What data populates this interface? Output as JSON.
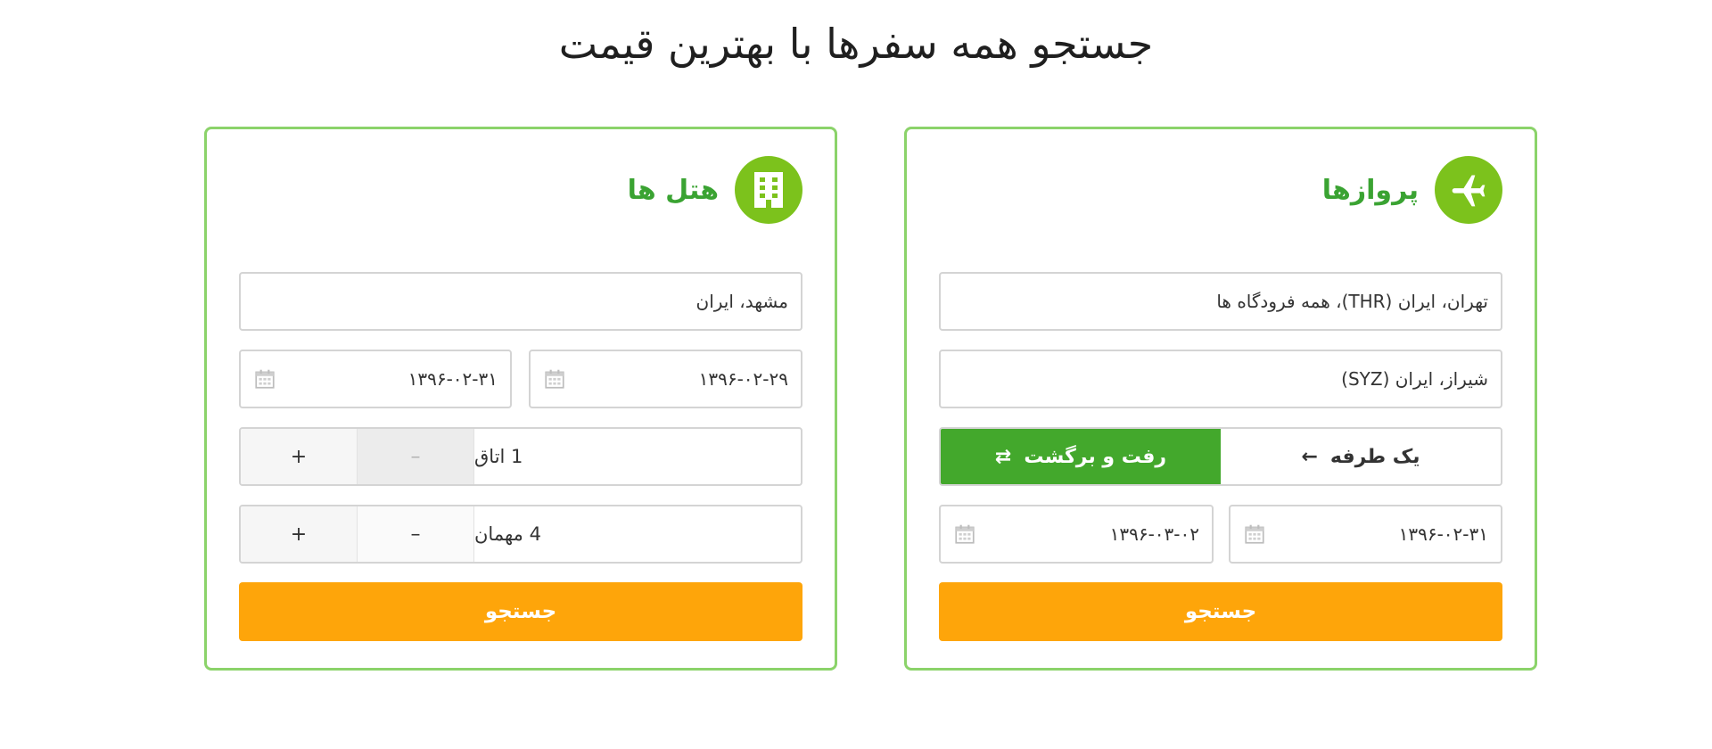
{
  "page": {
    "title": "جستجو همه سفرها با بهترین قیمت"
  },
  "flights": {
    "title": "پروازها",
    "icon": "airplane-icon",
    "origin": "تهران، ایران (THR)، همه فرودگاه ها",
    "destination": "شیراز، ایران (SYZ)",
    "trip_type": {
      "one_way": "یک طرفه",
      "round_trip": "رفت و برگشت",
      "selected": "round_trip"
    },
    "depart_date": "۱۳۹۶-۰۲-۳۱",
    "return_date": "۱۳۹۶-۰۳-۰۲",
    "search_label": "جستجو"
  },
  "hotels": {
    "title": "هتل ها",
    "icon": "building-icon",
    "city": "مشهد، ایران",
    "checkin_date": "۱۳۹۶-۰۲-۲۹",
    "checkout_date": "۱۳۹۶-۰۲-۳۱",
    "rooms": "1 اتاق",
    "guests": "4 مهمان",
    "minus": "–",
    "plus": "+",
    "search_label": "جستجو"
  },
  "colors": {
    "accent_green": "#3aa332",
    "icon_green": "#7cc21c",
    "toggle_green": "#43a82c",
    "border_green": "#8bd36a",
    "search_orange": "#fea50a"
  }
}
